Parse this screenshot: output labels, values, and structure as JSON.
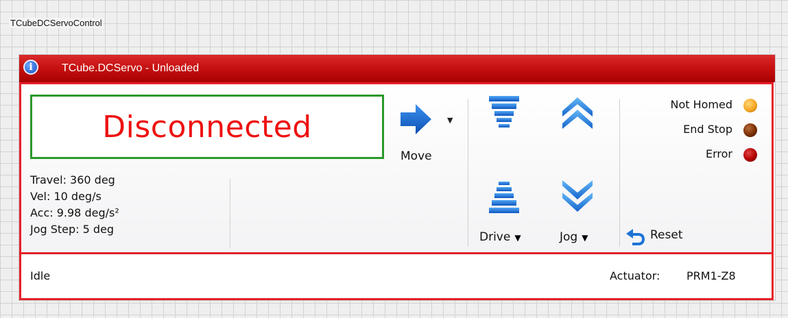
{
  "control": {
    "name": "TCubeDCServoControl"
  },
  "panel": {
    "title": "TCube.DCServo - Unloaded",
    "connection_status": "Disconnected",
    "params": {
      "travel": "Travel: 360 deg",
      "vel": "Vel: 10 deg/s",
      "acc": "Acc: 9.98 deg/s²",
      "jog_step": "Jog Step: 5 deg"
    },
    "buttons": {
      "move": "Move",
      "drive": "Drive",
      "jog": "Jog",
      "reset": "Reset",
      "dropdown_glyph": "▼"
    },
    "indicators": [
      {
        "label": "Not Homed",
        "color": "#f5a623",
        "icon": "indicator-led"
      },
      {
        "label": "End Stop",
        "color": "#7a2e00",
        "icon": "indicator-led"
      },
      {
        "label": "Error",
        "color": "#b30000",
        "icon": "indicator-led"
      }
    ],
    "status_bar": {
      "state": "Idle",
      "actuator_label": "Actuator:",
      "actuator_value": "PRM1-Z8"
    },
    "colors": {
      "title_bar": "#c81212",
      "panel_border": "#e4212a",
      "connection_box_border": "#2a9a2a",
      "connection_text": "#ee1111",
      "icon_blue": "#1e73d6"
    }
  }
}
